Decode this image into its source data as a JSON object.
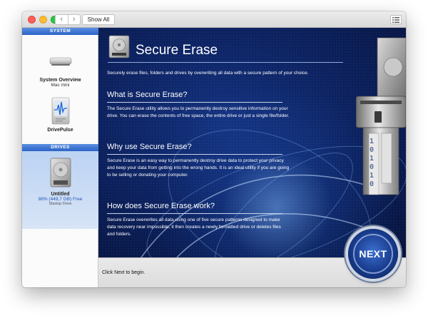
{
  "titlebar": {
    "back": "‹",
    "forward": "›",
    "show_all": "Show All"
  },
  "sidebar": {
    "system_header": "SYSTEM",
    "items": [
      {
        "title": "System Overview",
        "subtitle": "Mac mini"
      },
      {
        "title": "DrivePulse"
      }
    ],
    "drives_header": "DRIVES",
    "drive": {
      "title": "Untitled",
      "subtitle": "88% (449,7 GB) Free",
      "detail": "Startup Drive"
    }
  },
  "main": {
    "title": "Secure Erase",
    "intro": "Securely erase files, folders and drives by overwriting all data with a secure pattern of your choice.",
    "sections": [
      {
        "heading": "What is Secure Erase?",
        "body": "The Secure Erase utility allows you to permanently destroy sensitive information on your drive. You can erase the contents of free space, the entire drive or just a single file/folder."
      },
      {
        "heading": "Why use Secure Erase?",
        "body": "Secure Erase is an easy way to permanently destroy drive data to protect your privacy and keep your data from getting into the wrong hands. It is an ideal utility if you are going to be selling or donating your computer."
      },
      {
        "heading": "How does Secure Erase work?",
        "body": "Secure Erase overwrites all data using one of five secure patterns designed to make data recovery near impossible, it then creates a newly formatted drive or deletes files and folders."
      }
    ],
    "shred_digits": "101010"
  },
  "footer": {
    "hint": "Click Next to begin.",
    "next": "NEXT"
  },
  "colors": {
    "accent": "#2b63c6",
    "background": "#0b1f5a"
  },
  "icons": [
    "list-view-icon",
    "mac-mini-icon",
    "drivepulse-icon",
    "hard-drive-icon",
    "secure-erase-icon",
    "shredder-illustration"
  ]
}
